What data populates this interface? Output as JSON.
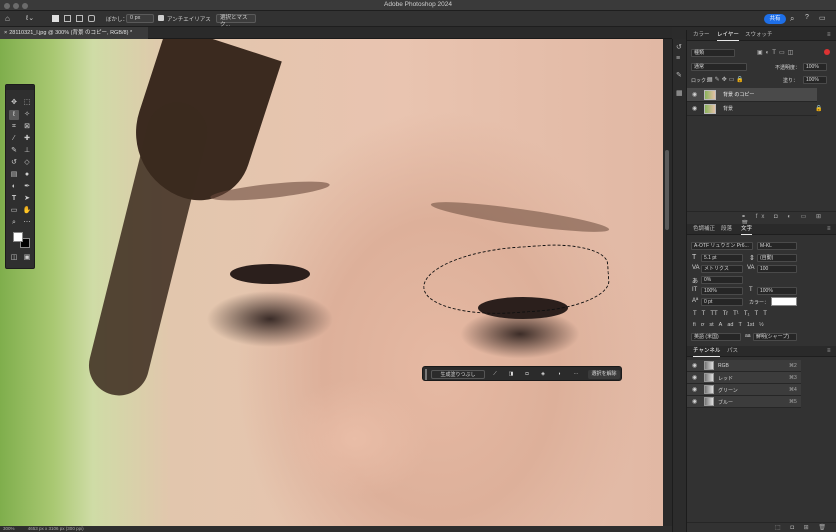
{
  "window": {
    "title": "Adobe Photoshop 2024"
  },
  "options_bar": {
    "feather_label": "ぼかし：",
    "feather_value": "0 px",
    "antialias_label": "アンチエイリアス",
    "select_mask_label": "選択とマスク...",
    "share_label": "共有"
  },
  "document": {
    "tab_title": "28110321_l.jpg @ 300% (背景 のコピー, RGB/8) *"
  },
  "status": {
    "zoom": "300%",
    "doc_info": "4653 px x 3106 px (300 ppi)"
  },
  "context_bar": {
    "generative_fill_label": "生成塗りつぶし",
    "deselect_label": "選択を解除",
    "more_label": "···"
  },
  "panels": {
    "top_tabs": [
      "カラー",
      "レイヤー",
      "スウォッチ"
    ],
    "active_top_tab": "レイヤー",
    "layers": {
      "filter_kind": "種類",
      "blend_mode": "通常",
      "opacity_label": "不透明度：",
      "opacity_value": "100%",
      "lock_label": "ロック：",
      "fill_label": "塗り：",
      "fill_value": "100%",
      "items": [
        {
          "name": "背景 のコピー",
          "selected": true
        },
        {
          "name": "背景",
          "selected": false
        }
      ]
    },
    "mid_tabs": [
      "色調補正",
      "段落",
      "文字"
    ],
    "active_mid_tab": "文字",
    "character": {
      "font_family": "A-OTF リュウミン Pr6...",
      "font_style": "M-KL",
      "size": "5.1 pt",
      "leading": "(自動)",
      "kerning": "メトリクス",
      "tracking": "100",
      "tsume": "0%",
      "vertical_scale": "100%",
      "horizontal_scale": "100%",
      "baseline_shift": "0 pt",
      "color_label": "カラー：",
      "language": "英語 (米国)",
      "antialias": "鮮明(シャープ)",
      "style_buttons": [
        "T",
        "T",
        "TT",
        "Tr",
        "T¹",
        "T₁",
        "T",
        "T"
      ],
      "opentype_buttons": [
        "fi",
        "ơ",
        "st",
        "A",
        "ad",
        "T",
        "1st",
        "½"
      ]
    },
    "bottom_tabs": [
      "チャンネル",
      "パス"
    ],
    "active_bottom_tab": "チャンネル",
    "channels": [
      {
        "name": "RGB",
        "shortcut": "⌘2"
      },
      {
        "name": "レッド",
        "shortcut": "⌘3"
      },
      {
        "name": "グリーン",
        "shortcut": "⌘4"
      },
      {
        "name": "ブルー",
        "shortcut": "⌘5"
      }
    ]
  },
  "tools": [
    "move-tool",
    "marquee-tool",
    "lasso-tool",
    "magic-wand-tool",
    "crop-tool",
    "frame-tool",
    "eyedropper-tool",
    "spot-healing-tool",
    "brush-tool",
    "clone-stamp-tool",
    "history-brush-tool",
    "eraser-tool",
    "gradient-tool",
    "blur-tool",
    "dodge-tool",
    "pen-tool",
    "type-tool",
    "path-selection-tool",
    "rectangle-tool",
    "hand-tool",
    "zoom-tool",
    "more-tools"
  ],
  "colors": {
    "accent": "#1e6fe8",
    "panel": "#323232",
    "foreground_swatch": "#ffffff",
    "background_swatch": "#000000"
  }
}
